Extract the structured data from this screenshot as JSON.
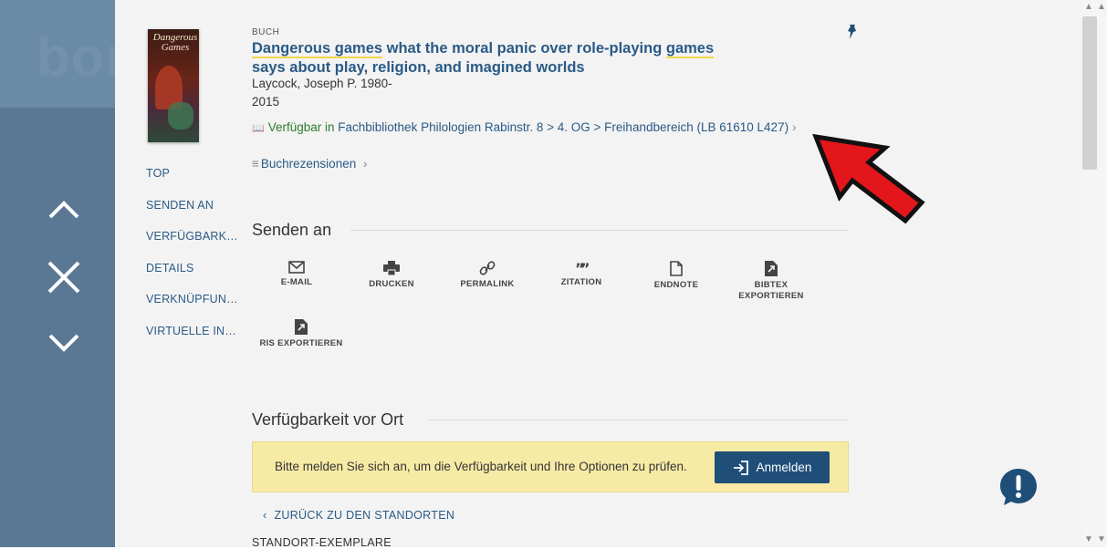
{
  "backdrop": {
    "logo_text": "bon"
  },
  "record": {
    "type_label": "BUCH",
    "title_part1": "Dangerous games",
    "title_part2": " what the moral panic over role-playing ",
    "title_part3": "games",
    "title_part4": " says about play, religion, and imagined worlds",
    "author": "Laycock, Joseph P. 1980-",
    "year": "2015",
    "availability_status": "Verfügbar",
    "availability_in": " in ",
    "availability_location": "Fachbibliothek Philologien  Rabinstr. 8 > 4. OG > Freihandbereich (LB 61610 L427)",
    "availability_chevron": "›",
    "reviews_label": "Buchrezensionen",
    "reviews_chevron": "›",
    "cover_title": "Dangerous Games"
  },
  "section_nav": {
    "items": [
      "TOP",
      "SENDEN AN",
      "VERFÜGBARKEIT",
      "DETAILS",
      "VERKNÜPFUNGEN",
      "VIRTUELLE INDEX"
    ]
  },
  "send": {
    "heading": "Senden an",
    "actions": [
      {
        "label": "E-MAIL",
        "icon": "mail-icon"
      },
      {
        "label": "DRUCKEN",
        "icon": "print-icon"
      },
      {
        "label": "PERMALINK",
        "icon": "link-icon"
      },
      {
        "label": "ZITATION",
        "icon": "quote-icon"
      },
      {
        "label": "ENDNOTE",
        "icon": "document-icon"
      },
      {
        "label": "BIBTEX EXPORTIEREN",
        "icon": "export-file-icon"
      },
      {
        "label": "RIS EXPORTIEREN",
        "icon": "export-file-icon"
      }
    ]
  },
  "availability": {
    "heading": "Verfügbarkeit vor Ort",
    "login_message": "Bitte melden Sie sich an, um die Verfügbarkeit und Ihre Optionen zu prüfen.",
    "login_button": "Anmelden",
    "back_link": "ZURÜCK ZU DEN STANDORTEN",
    "copies_heading": "STANDORT-EXEMPLARE"
  },
  "colors": {
    "link": "#2a5a86",
    "available": "#2d7a2d",
    "login_bg": "#f7eaa5",
    "button_bg": "#1f4e79",
    "annotation_arrow": "#e3161b"
  }
}
